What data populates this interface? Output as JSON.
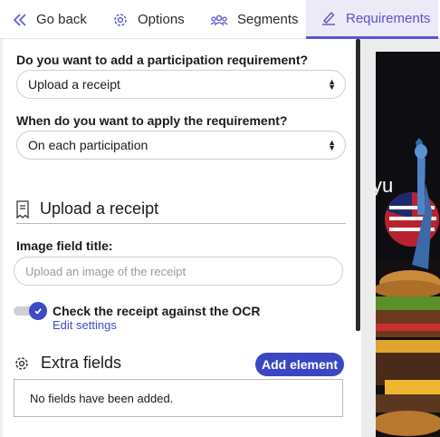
{
  "tabs": {
    "back": "Go back",
    "options": "Options",
    "segments": "Segments",
    "requirements": "Requirements"
  },
  "participation": {
    "question": "Do you want to add a participation requirement?",
    "selected": "Upload a receipt"
  },
  "apply": {
    "question": "When do you want to apply the requirement?",
    "selected": "On each participation"
  },
  "receipt_section": {
    "title": "Upload a receipt",
    "icon": "receipt-icon"
  },
  "image_field": {
    "label": "Image field title:",
    "placeholder": "Upload an image of the receipt",
    "value": ""
  },
  "ocr": {
    "label": "Check the receipt against the OCR",
    "enabled": true,
    "edit_link": "Edit settings"
  },
  "extra_fields": {
    "title": "Extra fields",
    "add_button": "Add element",
    "empty_message": "No fields have been added."
  },
  "colors": {
    "accent": "#3b46c4",
    "active_tab_bg": "#eceaf6",
    "active_tab_text": "#5a52c8"
  }
}
